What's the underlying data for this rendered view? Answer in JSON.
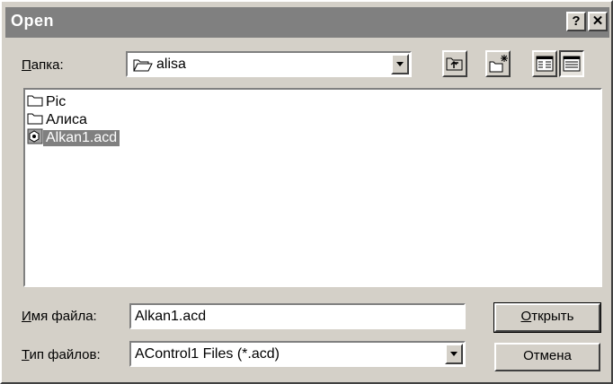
{
  "window": {
    "title": "Open",
    "help_label": "?",
    "close_label": "✕"
  },
  "lookin": {
    "label_prefix": "",
    "label_hotkey": "П",
    "label_rest": "апка:",
    "value": "alisa",
    "folder_icon": "open-folder-icon"
  },
  "toolbar": {
    "up_icon": "up-one-level-icon",
    "new_folder_icon": "create-new-folder-icon",
    "list_icon": "list-view-icon",
    "details_icon": "details-view-icon"
  },
  "files": [
    {
      "name": "Pic",
      "icon": "folder-icon"
    },
    {
      "name": "Алиса",
      "icon": "folder-icon"
    },
    {
      "name": "Alkan1.acd",
      "icon": "acd-file-icon",
      "selected": true
    }
  ],
  "filename": {
    "label_hotkey": "И",
    "label_rest": "мя файла:",
    "value": "Alkan1.acd"
  },
  "filetype": {
    "label_hotkey": "Т",
    "label_rest": "ип файлов:",
    "value": "AControl1 Files (*.acd)"
  },
  "buttons": {
    "open_hotkey": "О",
    "open_rest": "ткрыть",
    "cancel": "Отмена"
  }
}
